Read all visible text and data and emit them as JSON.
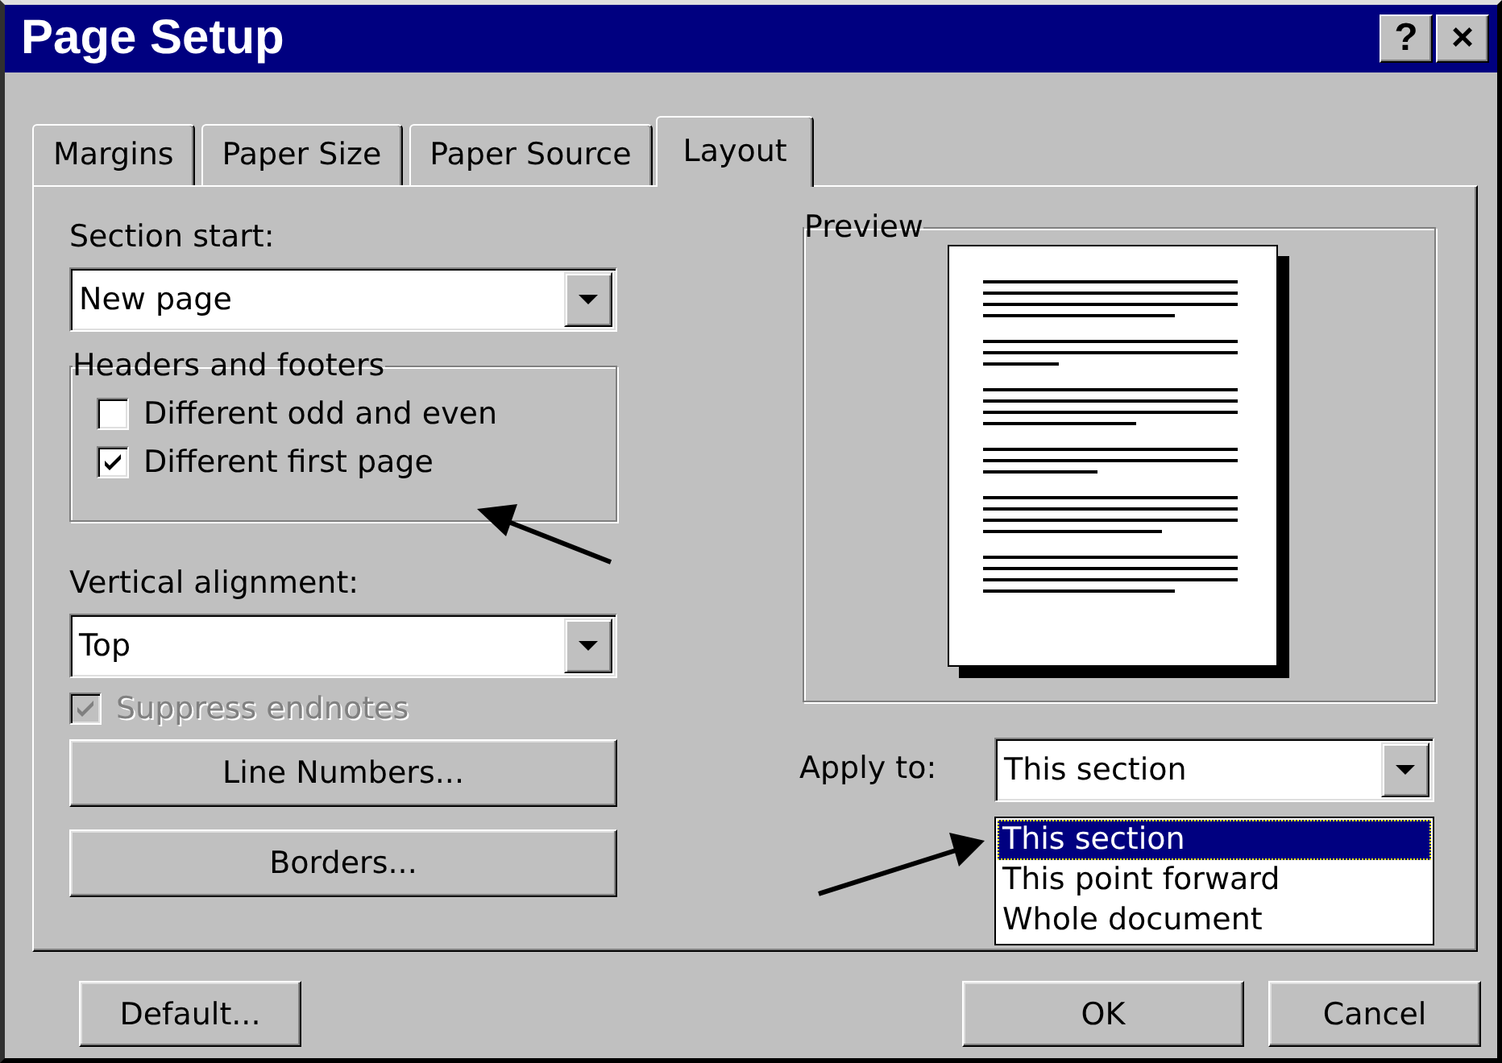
{
  "window": {
    "title": "Page Setup",
    "help_button": "?",
    "close_button": "×"
  },
  "tabs": [
    {
      "label": "Margins",
      "selected": false
    },
    {
      "label": "Paper Size",
      "selected": false
    },
    {
      "label": "Paper Source",
      "selected": false
    },
    {
      "label": "Layout",
      "selected": true
    }
  ],
  "section_start": {
    "label": "Section start:",
    "value": "New page"
  },
  "headers_and_footers": {
    "title": "Headers and footers",
    "options": [
      {
        "label": "Different odd and even",
        "checked": false
      },
      {
        "label": "Different first page",
        "checked": true
      }
    ]
  },
  "vertical_alignment": {
    "label": "Vertical alignment:",
    "value": "Top"
  },
  "suppress_endnotes": {
    "label": "Suppress endnotes",
    "checked": true,
    "disabled": true
  },
  "action_buttons": [
    {
      "label": "Line Numbers..."
    },
    {
      "label": "Borders..."
    }
  ],
  "preview": {
    "title": "Preview"
  },
  "apply_to": {
    "label": "Apply to:",
    "value": "This section",
    "expanded": true,
    "options": [
      {
        "label": "This section",
        "selected": true
      },
      {
        "label": "This point forward",
        "selected": false
      },
      {
        "label": "Whole document",
        "selected": false
      }
    ]
  },
  "buttons": [
    {
      "label": "Default..."
    },
    {
      "label": "OK"
    },
    {
      "label": "Cancel"
    }
  ]
}
